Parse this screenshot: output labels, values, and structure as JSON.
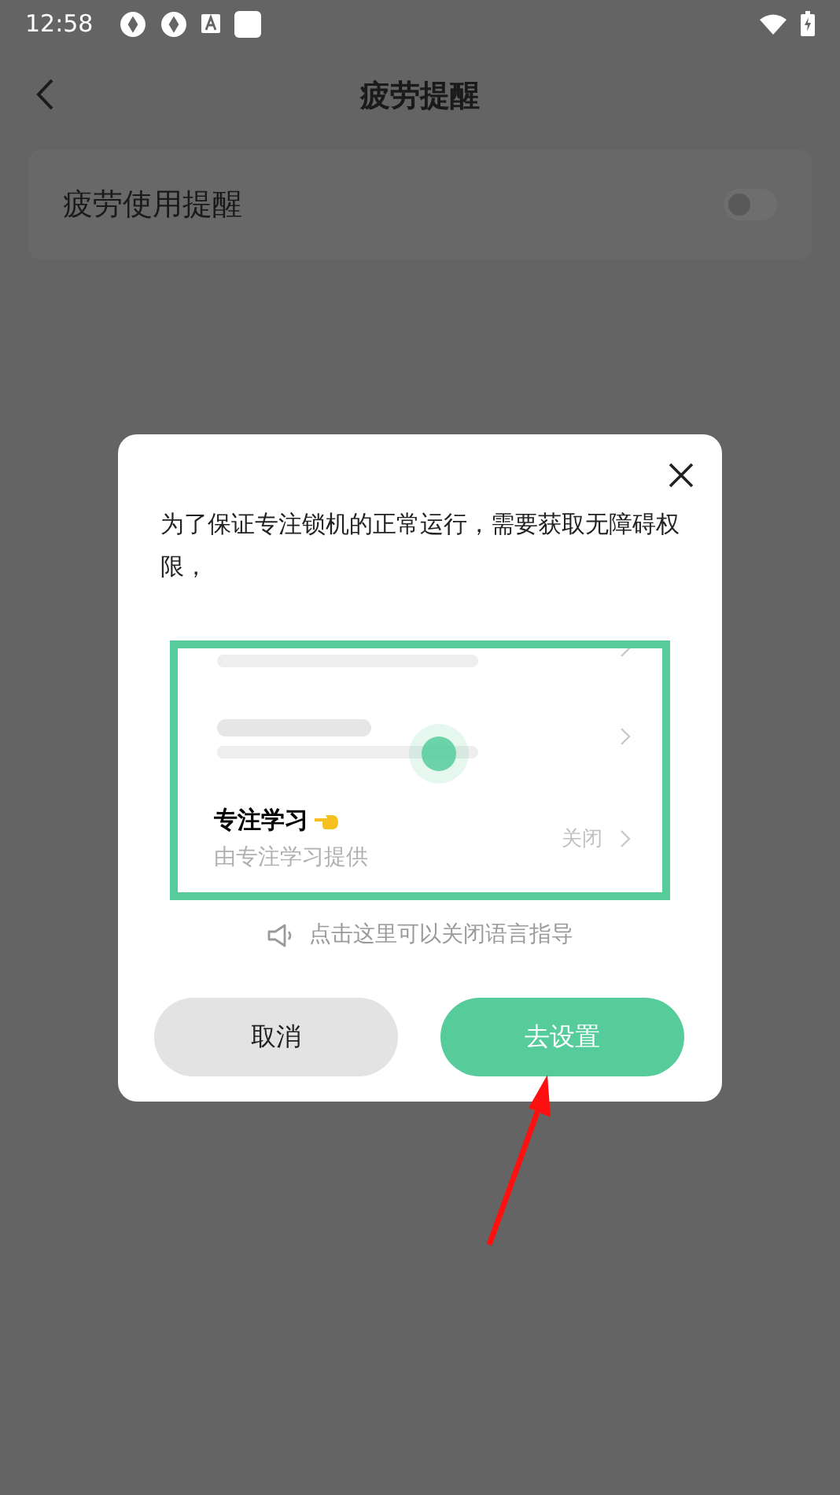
{
  "status_bar": {
    "time": "12:58"
  },
  "header": {
    "title": "疲劳提醒"
  },
  "setting": {
    "label": "疲劳使用提醒",
    "on": false
  },
  "dialog": {
    "message": "为了保证专注锁机的正常运行，需要获取无障碍权限，",
    "illustration": {
      "title": "专注学习",
      "subtitle": "由专注学习提供",
      "action": "关闭"
    },
    "hint": "点击这里可以关闭语言指导",
    "buttons": [
      {
        "label": "取消",
        "kind": "secondary"
      },
      {
        "label": "去设置",
        "kind": "primary"
      }
    ]
  }
}
